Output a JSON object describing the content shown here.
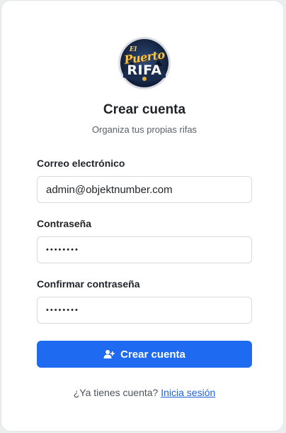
{
  "brand": {
    "logo_name": "el-puerto-rifa-logo",
    "logo_text": [
      "El",
      "Puerto",
      "RIFA"
    ]
  },
  "header": {
    "title": "Crear cuenta",
    "subtitle": "Organiza tus propias rifas"
  },
  "form": {
    "email": {
      "label": "Correo electrónico",
      "value": "admin@objektnumber.com"
    },
    "password": {
      "label": "Contraseña",
      "value": "••••••••"
    },
    "confirm_password": {
      "label": "Confirmar contraseña",
      "value": "••••••••"
    },
    "submit": {
      "label": "Crear cuenta",
      "icon": "user-plus-icon"
    }
  },
  "footer": {
    "prompt": "¿Ya tienes cuenta?",
    "link_label": "Inicia sesión"
  },
  "colors": {
    "primary": "#1e6bf2",
    "link": "#1e63d8",
    "background": "#ecedef",
    "card": "#ffffff"
  }
}
